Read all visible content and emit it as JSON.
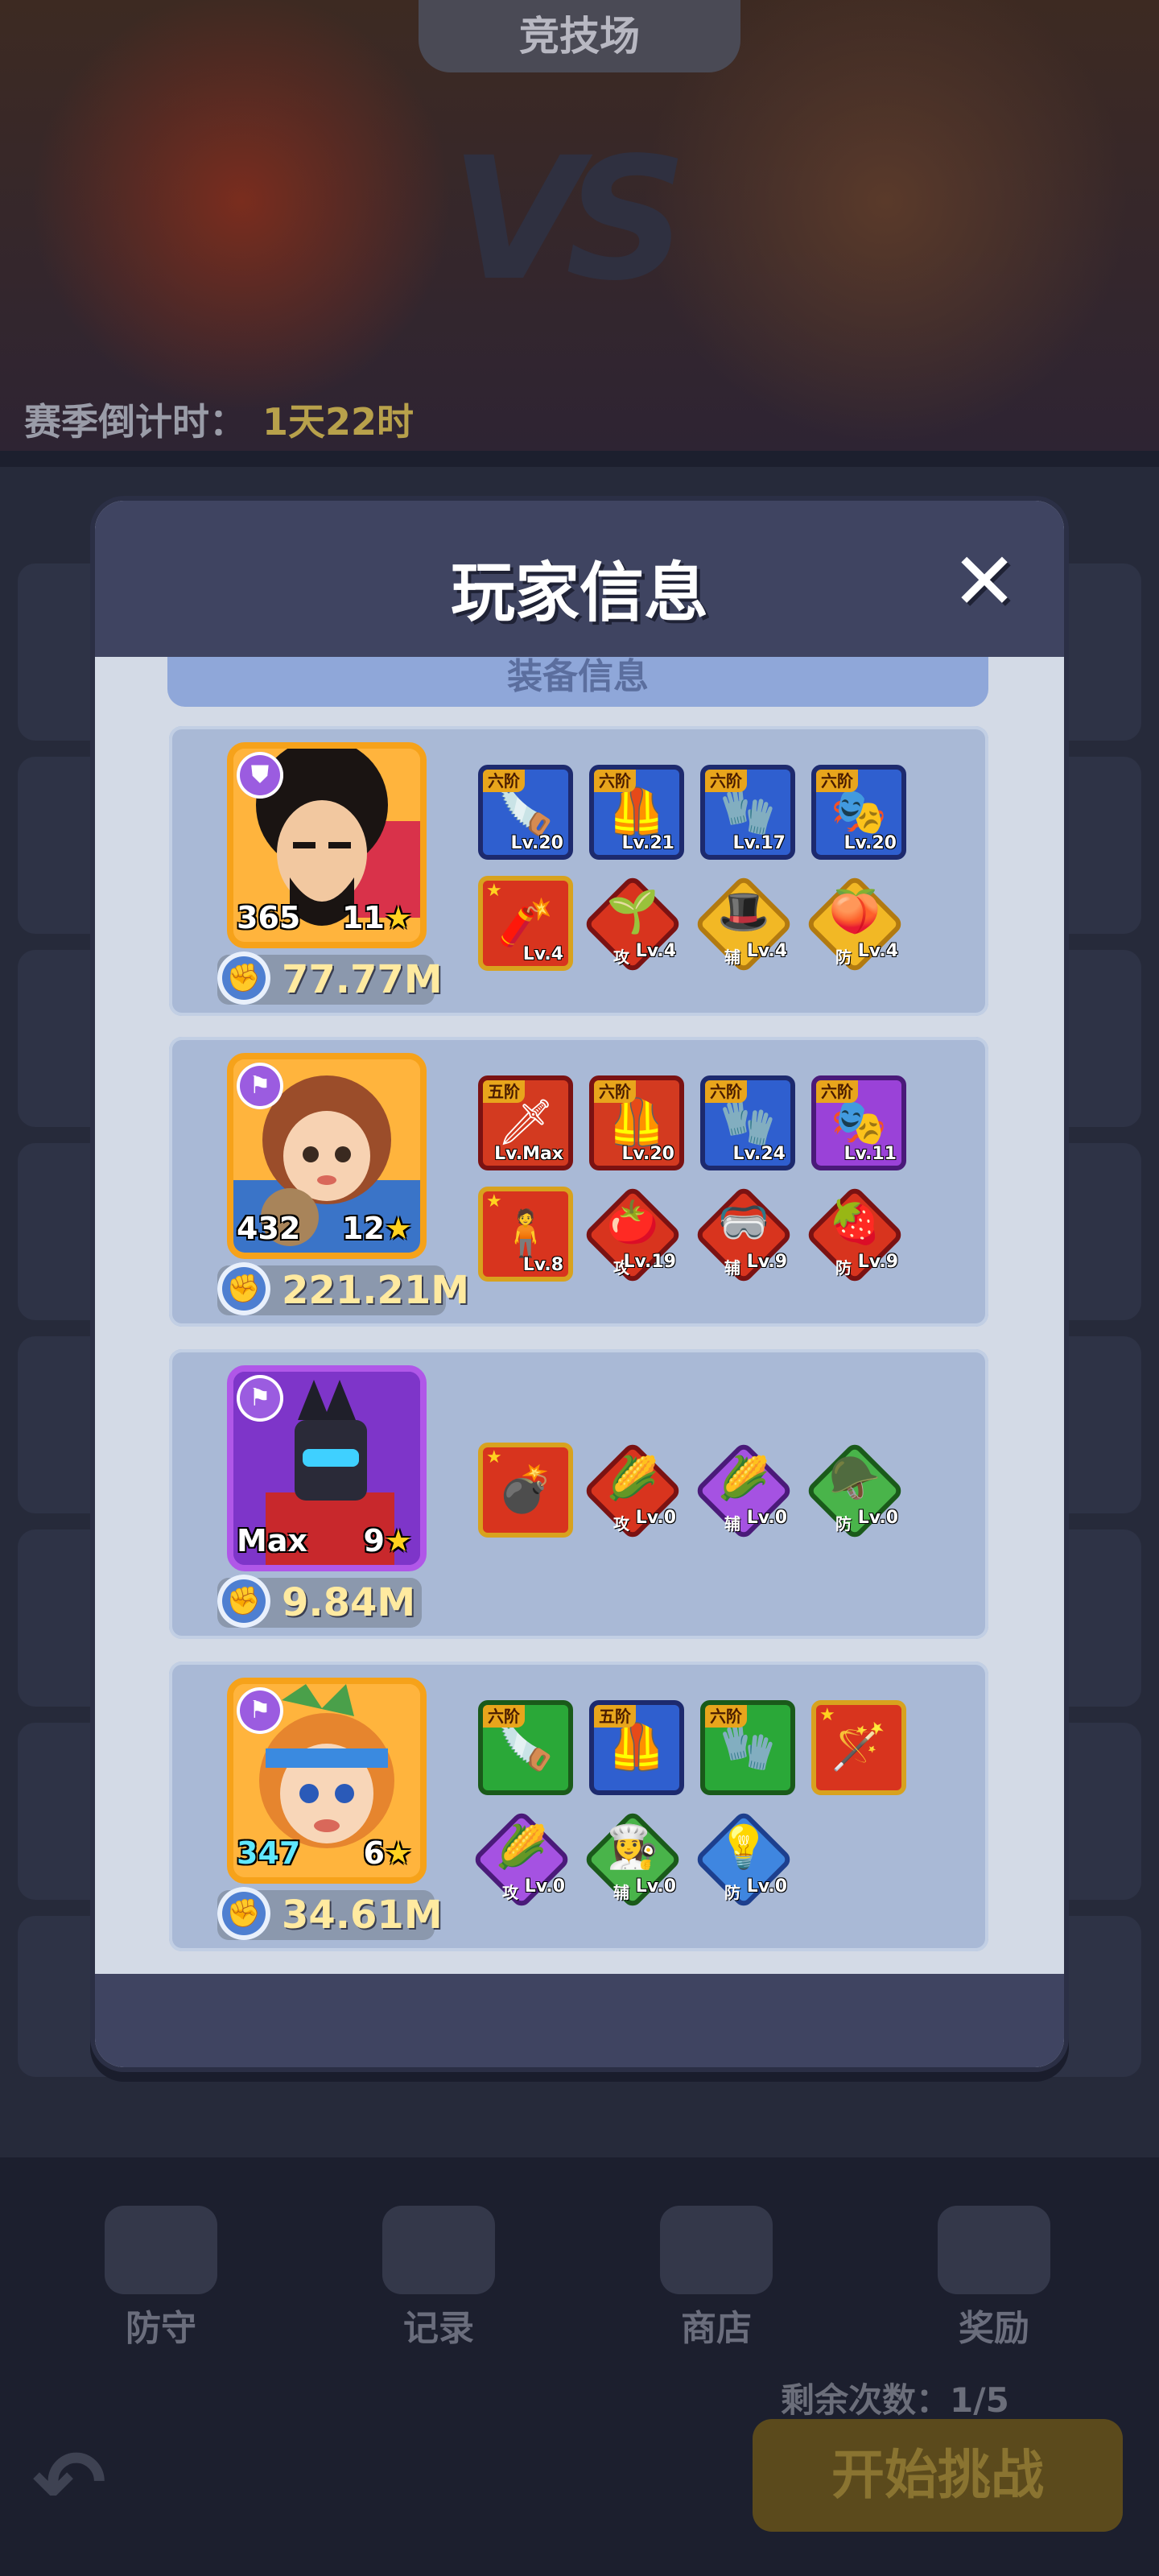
{
  "background": {
    "title": "竞技场",
    "vs_label": "VS",
    "countdown_label": "赛季倒计时：",
    "countdown_value": "1天22时",
    "nav": [
      {
        "label": "防守",
        "icon": "shield-icon"
      },
      {
        "label": "记录",
        "icon": "record-icon"
      },
      {
        "label": "商店",
        "icon": "shop-icon"
      },
      {
        "label": "奖励",
        "icon": "gift-icon"
      }
    ],
    "remaining_label": "剩余次数：1/5",
    "start_button": "开始挑战"
  },
  "modal": {
    "title": "玩家信息",
    "close_icon": "close-icon",
    "section_tab": "装备信息",
    "heroes": [
      {
        "name_icon": "afro-hero-portrait",
        "rarity": "gold",
        "level": "365",
        "stars": "11",
        "power": "77.77M",
        "equipment": [
          {
            "tier": "六阶",
            "level": "Lv.20",
            "color": "blue",
            "icon": "chainsaw-icon"
          },
          {
            "tier": "六阶",
            "level": "Lv.21",
            "color": "blue",
            "icon": "armor-icon"
          },
          {
            "tier": "六阶",
            "level": "Lv.17",
            "color": "blue",
            "icon": "gauntlet-icon"
          },
          {
            "tier": "六阶",
            "level": "Lv.20",
            "color": "blue",
            "icon": "mask-icon"
          },
          {
            "tier": "",
            "level": "Lv.4",
            "color": "redgold",
            "icon": "cannon-icon"
          }
        ],
        "pets": [
          {
            "role": "攻",
            "level": "Lv.4",
            "color": "red",
            "icon": "pet-plant-icon"
          },
          {
            "role": "辅",
            "level": "Lv.4",
            "color": "gold",
            "icon": "pet-hat-icon"
          },
          {
            "role": "防",
            "level": "Lv.4",
            "color": "gold",
            "icon": "pet-peach-icon"
          }
        ]
      },
      {
        "name_icon": "girl-hero-portrait",
        "rarity": "gold",
        "level": "432",
        "stars": "12",
        "power": "221.21M",
        "equipment": [
          {
            "tier": "五阶",
            "level": "Lv.Max",
            "color": "red",
            "icon": "shovel-icon"
          },
          {
            "tier": "六阶",
            "level": "Lv.20",
            "color": "red",
            "icon": "armor-icon"
          },
          {
            "tier": "六阶",
            "level": "Lv.24",
            "color": "blue",
            "icon": "gauntlet-icon"
          },
          {
            "tier": "六阶",
            "level": "Lv.11",
            "color": "purple",
            "icon": "mask-icon"
          },
          {
            "tier": "",
            "level": "Lv.8",
            "color": "redgold",
            "icon": "figure-icon"
          }
        ],
        "pets": [
          {
            "role": "攻",
            "level": "Lv.19",
            "color": "red",
            "icon": "pet-tomato-icon"
          },
          {
            "role": "辅",
            "level": "Lv.9",
            "color": "red",
            "icon": "pet-goggles-icon"
          },
          {
            "role": "防",
            "level": "Lv.9",
            "color": "red",
            "icon": "pet-berry-icon"
          }
        ]
      },
      {
        "name_icon": "robot-hero-portrait",
        "rarity": "purple",
        "level": "Max",
        "stars": "9",
        "power": "9.84M",
        "equipment": [
          {
            "tier": "",
            "level": "",
            "color": "redgold",
            "icon": "grenade-icon"
          }
        ],
        "pets": [
          {
            "role": "攻",
            "level": "Lv.0",
            "color": "red",
            "icon": "pet-corn-icon"
          },
          {
            "role": "辅",
            "level": "Lv.0",
            "color": "purple",
            "icon": "pet-corn-icon"
          },
          {
            "role": "防",
            "level": "Lv.0",
            "color": "green",
            "icon": "pet-helmet-icon"
          }
        ]
      },
      {
        "name_icon": "headband-hero-portrait",
        "rarity": "gold",
        "level": "347",
        "stars": "6",
        "power": "34.61M",
        "equipment": [
          {
            "tier": "六阶",
            "level": "",
            "color": "green",
            "icon": "chainsaw-icon"
          },
          {
            "tier": "五阶",
            "level": "",
            "color": "blue",
            "icon": "armor-icon"
          },
          {
            "tier": "六阶",
            "level": "",
            "color": "green",
            "icon": "gauntlet-icon"
          },
          {
            "tier": "",
            "level": "",
            "color": "redgold",
            "icon": "wand-icon"
          }
        ],
        "pets": [
          {
            "role": "攻",
            "level": "Lv.0",
            "color": "purple",
            "icon": "pet-corn-icon"
          },
          {
            "role": "辅",
            "level": "Lv.0",
            "color": "green",
            "icon": "pet-chef-icon"
          },
          {
            "role": "防",
            "level": "Lv.0",
            "color": "blue",
            "icon": "pet-bulb-icon"
          }
        ]
      }
    ]
  }
}
